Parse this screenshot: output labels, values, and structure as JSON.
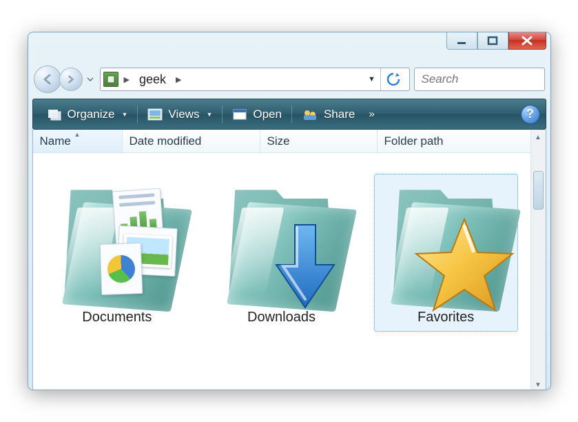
{
  "window_controls": {
    "minimize": "minimize",
    "maximize": "maximize",
    "close": "close"
  },
  "breadcrumb": {
    "current": "geek"
  },
  "search": {
    "placeholder": "Search"
  },
  "toolbar": {
    "organize": "Organize",
    "views": "Views",
    "open": "Open",
    "share": "Share"
  },
  "columns": {
    "name": "Name",
    "date": "Date modified",
    "size": "Size",
    "path": "Folder path",
    "sort_column": "name",
    "sort_dir": "asc"
  },
  "items": [
    {
      "label": "Documents",
      "selected": false,
      "kind": "documents"
    },
    {
      "label": "Downloads",
      "selected": false,
      "kind": "downloads"
    },
    {
      "label": "Favorites",
      "selected": true,
      "kind": "favorites"
    }
  ]
}
